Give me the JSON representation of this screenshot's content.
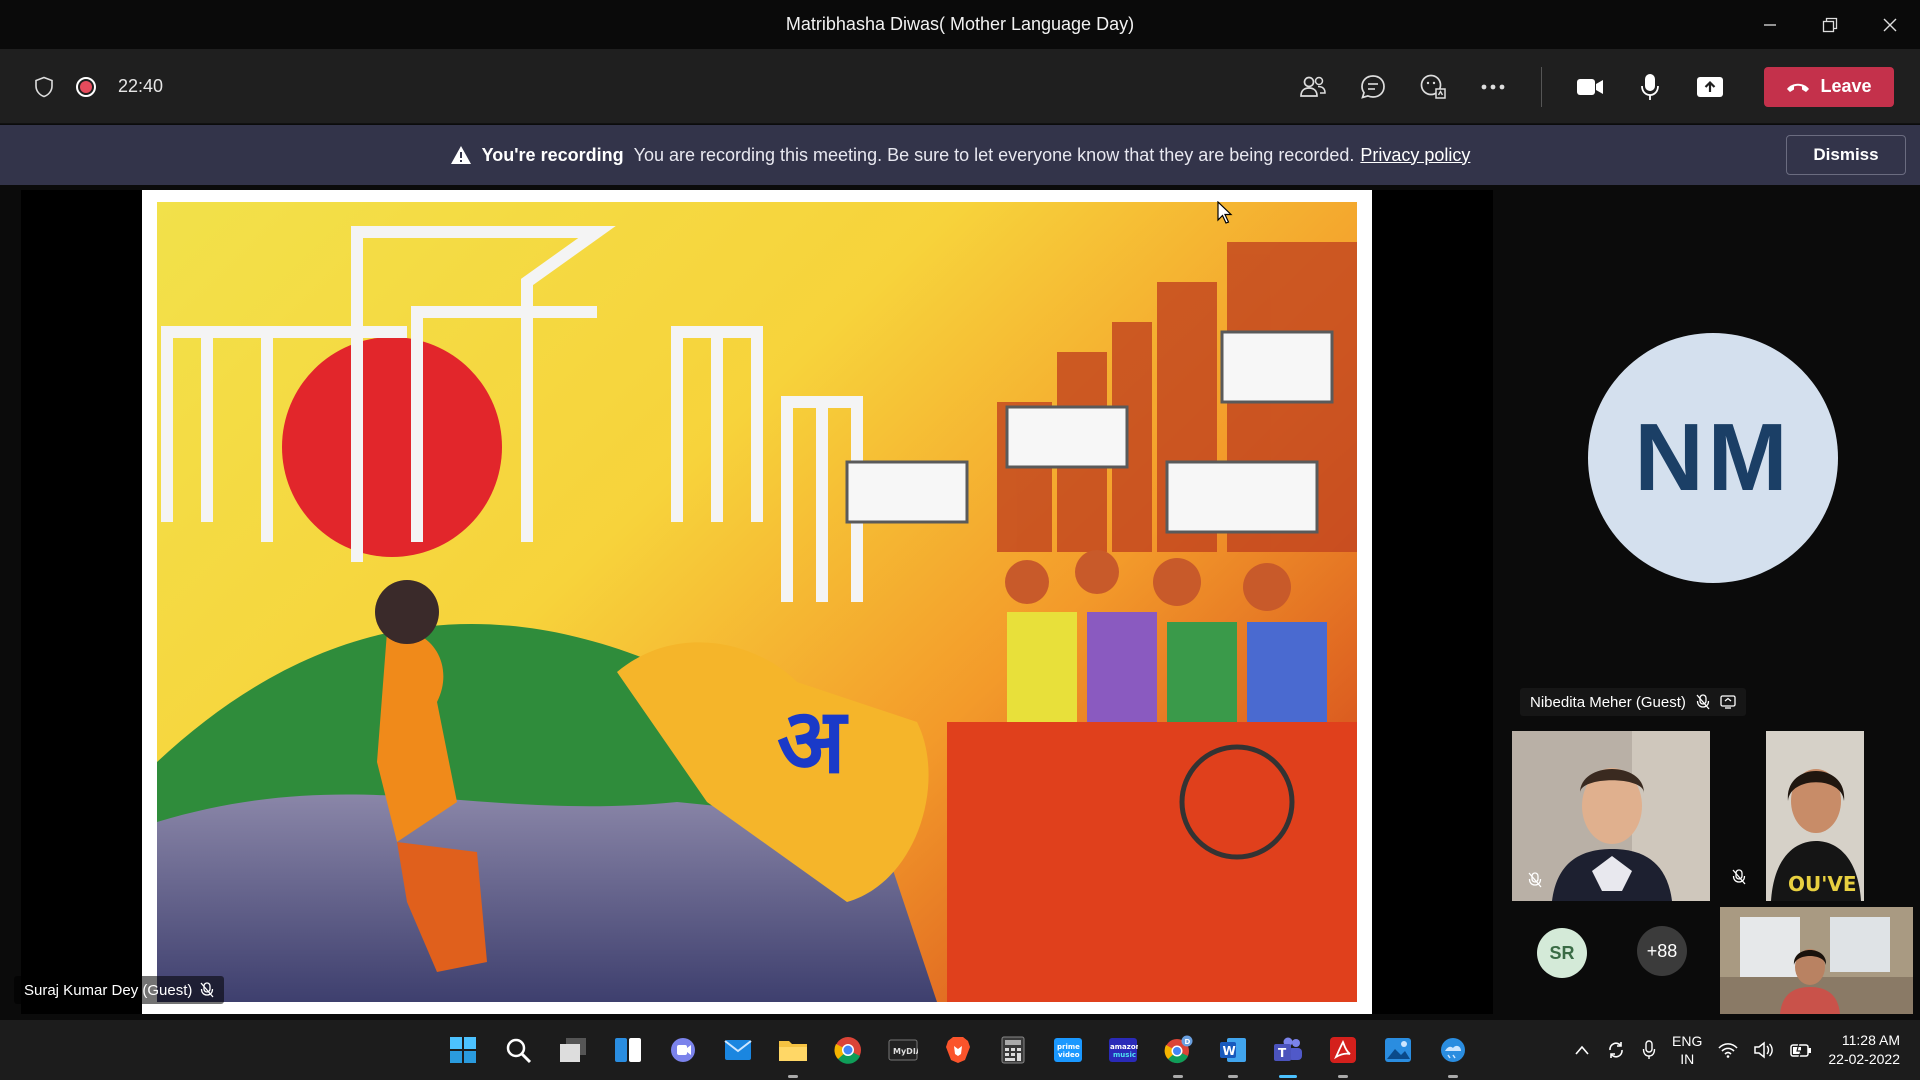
{
  "window": {
    "title": "Matribhasha Diwas( Mother Language Day)",
    "controls": [
      "minimize",
      "restore",
      "close"
    ]
  },
  "meeting": {
    "timer": "22:40",
    "leave_label": "Leave",
    "tools": [
      "people-icon",
      "chat-icon",
      "reactions-icon",
      "more-icon",
      "camera-icon",
      "mic-icon",
      "share-icon"
    ]
  },
  "banner": {
    "title": "You're recording",
    "message": "You are recording this meeting. Be sure to let everyone know that they are being recorded.",
    "link": "Privacy policy",
    "dismiss_label": "Dismiss"
  },
  "presenter": {
    "name": "Suraj Kumar Dey (Guest)"
  },
  "featured": {
    "initials": "NM",
    "name": "Nibedita Meher (Guest)"
  },
  "participants": {
    "sr_initials": "SR",
    "overflow": "+88"
  },
  "taskbar": {
    "apps": [
      "start",
      "search",
      "task-view",
      "widgets",
      "teams-chat",
      "mail",
      "file-explorer",
      "chrome",
      "msi",
      "brave",
      "calculator",
      "prime-video",
      "amazon-music",
      "chrome-profile",
      "word",
      "teams",
      "acrobat",
      "photos",
      "weather"
    ],
    "lang_line1": "ENG",
    "lang_line2": "IN",
    "time": "11:28 AM",
    "date": "22-02-2022"
  },
  "colors": {
    "leave": "#c4314b",
    "banner": "#33344a",
    "avatar_bg": "#d4e0ee",
    "avatar_text": "#1b3f66"
  }
}
